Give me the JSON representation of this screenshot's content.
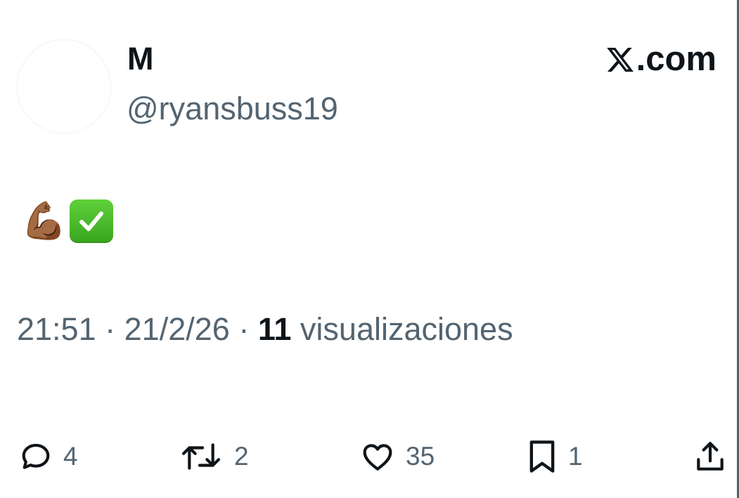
{
  "author": {
    "display_name": "M",
    "handle": "@ryansbuss19"
  },
  "brand": {
    "suffix": ".com"
  },
  "post": {
    "content_emoji": [
      "💪🏾",
      "✅"
    ]
  },
  "meta": {
    "time": "21:51",
    "separator": "·",
    "date": "21/2/26",
    "views_count": "11",
    "views_label": "visualizaciones"
  },
  "actions": {
    "replies": "4",
    "reposts": "2",
    "likes": "35",
    "bookmarks": "1"
  },
  "icons": {
    "reply": "reply-icon",
    "repost": "repost-icon",
    "like": "heart-icon",
    "bookmark": "bookmark-icon",
    "share": "share-icon",
    "brand": "x-logo-icon"
  },
  "colors": {
    "text_primary": "#0f1419",
    "text_secondary": "#536471",
    "check_green": "#3aa51f",
    "muscle_skin": "#7a4a2a"
  }
}
